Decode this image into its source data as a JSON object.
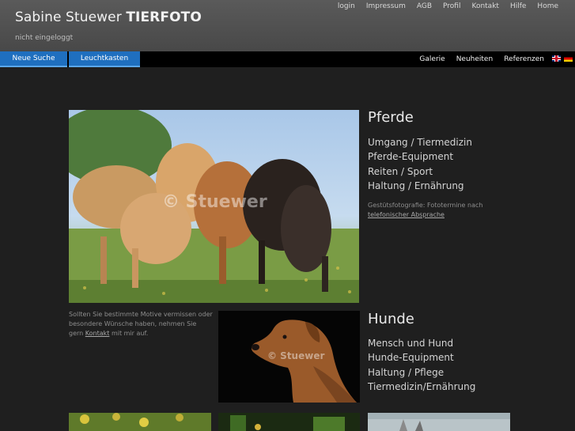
{
  "header": {
    "brand_name": "Sabine Stuewer",
    "brand_strong": "TIERFOTO",
    "login_state": "nicht eingeloggt",
    "top_nav": [
      "login",
      "Impressum",
      "AGB",
      "Profil",
      "Kontakt",
      "Hilfe",
      "Home"
    ]
  },
  "menubar": {
    "left_buttons": [
      "Neue Suche",
      "Leuchtkasten"
    ],
    "right_nav": [
      "Galerie",
      "Neuheiten",
      "Referenzen"
    ],
    "flags": [
      "uk-flag-icon",
      "de-flag-icon"
    ]
  },
  "colors": {
    "header_bg": "#505050",
    "button_bg": "#1f6fbf",
    "page_bg": "#1f1f1f"
  },
  "pferde": {
    "title": "Pferde",
    "links": [
      "Umgang / Tiermedizin",
      "Pferde-Equipment",
      "Reiten / Sport",
      "Haltung / Ernährung"
    ],
    "note_prefix": "Gestütsfotografie: Fototermine nach",
    "note_link": "telefonischer Absprache",
    "watermark": "© Stuewer"
  },
  "contact_note": {
    "prefix": "Sollten Sie bestimmte Motive vermissen oder besondere Wünsche haben, nehmen Sie gern",
    "link": "Kontakt",
    "suffix": "mit mir auf."
  },
  "hunde": {
    "title": "Hunde",
    "links": [
      "Mensch und Hund",
      "Hunde-Equipment",
      "Haltung / Pflege",
      "Tiermedizin/Ernährung"
    ],
    "watermark": "© Stuewer"
  }
}
